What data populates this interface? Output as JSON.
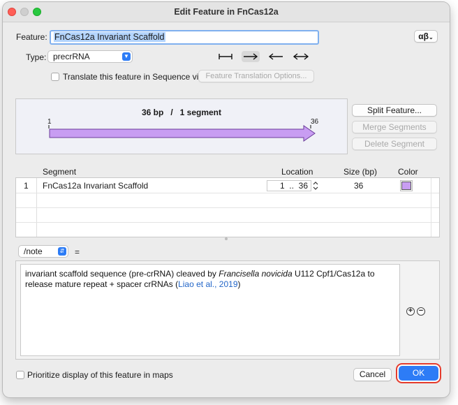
{
  "window": {
    "title": "Edit Feature in FnCas12a"
  },
  "feature": {
    "label": "Feature:",
    "name": "FnCas12a Invariant Scaffold",
    "alphabet_button": "αβ"
  },
  "type": {
    "label": "Type:",
    "value": "precrRNA"
  },
  "directions": {
    "items": [
      {
        "icon": "line-both-bars",
        "active": false
      },
      {
        "icon": "arrow-right",
        "active": true
      },
      {
        "icon": "arrow-left",
        "active": false
      },
      {
        "icon": "arrow-both",
        "active": false
      }
    ]
  },
  "translate": {
    "checkbox_label": "Translate this feature in Sequence view",
    "options_button": "Feature Translation Options..."
  },
  "map": {
    "summary": "36 bp   /   1 segment",
    "start": "1",
    "end": "36",
    "arrow_color": "#c89df2"
  },
  "segment_buttons": {
    "split": "Split Feature...",
    "merge": "Merge Segments",
    "delete": "Delete Segment"
  },
  "table": {
    "columns": [
      "Segment",
      "Location",
      "Size (bp)",
      "Color"
    ],
    "rows": [
      {
        "index": "1",
        "segment": "FnCas12a Invariant Scaffold",
        "location": "1  ..  36",
        "size": "36",
        "color": "#c89df2"
      }
    ]
  },
  "qualifier": {
    "key": "/note",
    "equals": "="
  },
  "note": {
    "text_before": "invariant scaffold sequence (pre-crRNA) cleaved by ",
    "italic": "Francisella novicida",
    "text_after": " U112 Cpf1/Cas12a to release mature repeat + spacer crRNAs (",
    "link": "Liao et al., 2019",
    "text_end": ")"
  },
  "footer": {
    "prioritize_label": "Prioritize display of this feature in maps",
    "cancel": "Cancel",
    "ok": "OK"
  },
  "colors": {
    "accent": "#2d7cf6",
    "highlight_ring": "#e53b2c"
  }
}
